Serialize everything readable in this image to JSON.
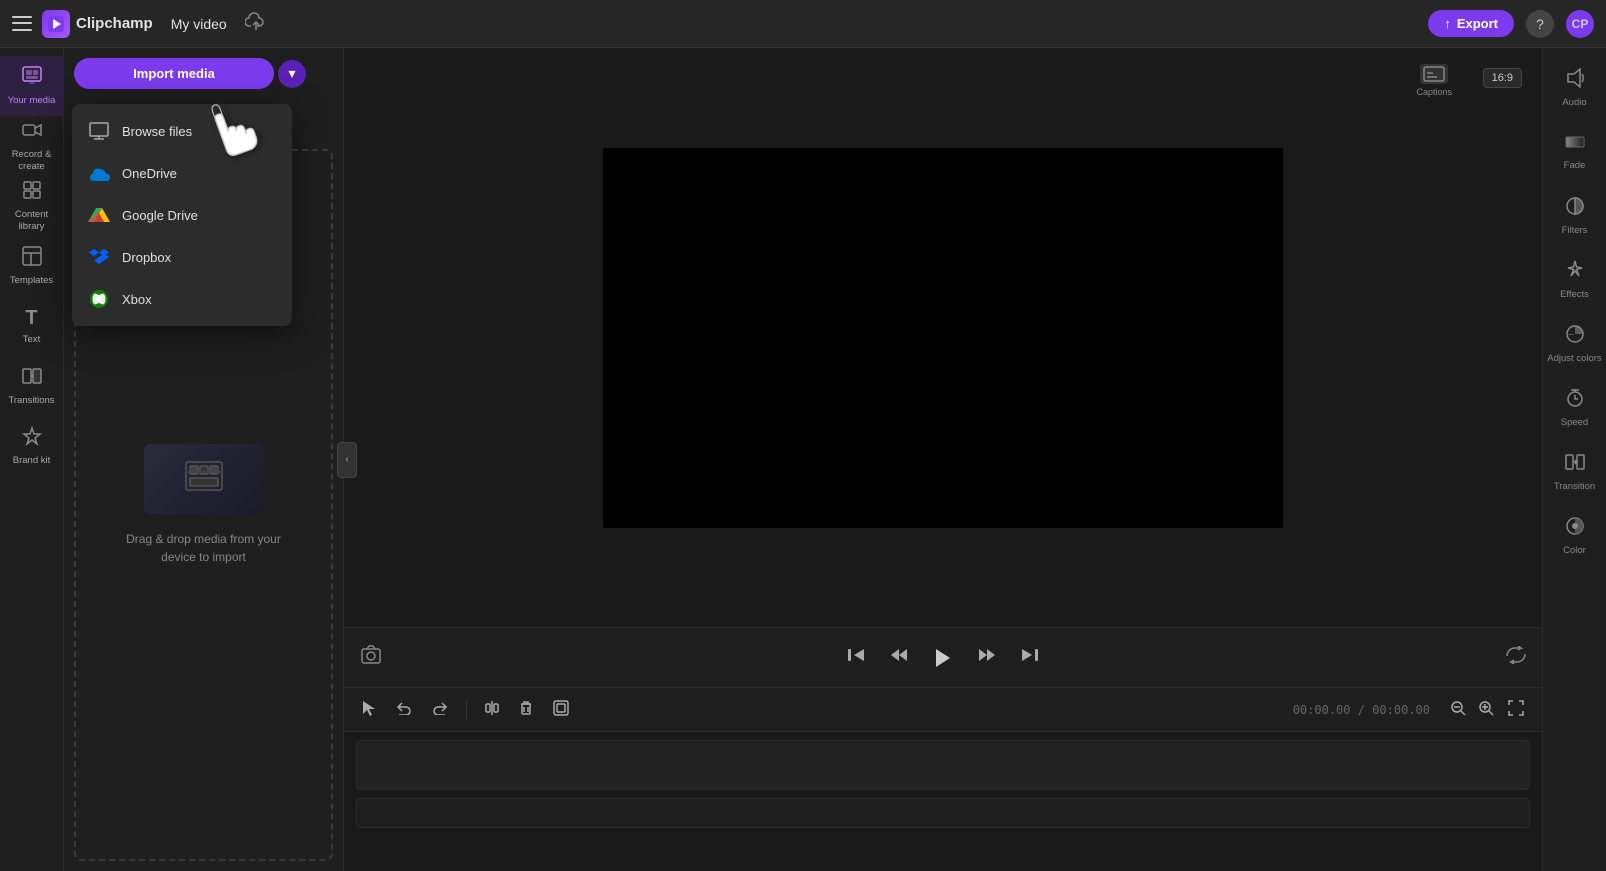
{
  "app": {
    "name": "Clipchamp",
    "logo_char": "▶",
    "video_title": "My video",
    "cloud_save_status": "unsaved"
  },
  "topbar": {
    "export_label": "Export",
    "aspect_ratio": "16:9",
    "captions_label": "Captions",
    "help_icon_label": "?",
    "avatar_label": "CP"
  },
  "left_sidebar": {
    "items": [
      {
        "id": "your-media",
        "icon": "🎞",
        "label": "Your media",
        "active": true
      },
      {
        "id": "record-create",
        "icon": "🎥",
        "label": "Record &\ncreate",
        "active": false
      },
      {
        "id": "content-library",
        "icon": "📚",
        "label": "Content\nlibrary",
        "active": false
      },
      {
        "id": "templates",
        "icon": "⊞",
        "label": "Templates",
        "active": false
      },
      {
        "id": "text",
        "icon": "T",
        "label": "Text",
        "active": false
      },
      {
        "id": "transitions",
        "icon": "◧",
        "label": "Transitions",
        "active": false
      },
      {
        "id": "brand-kit",
        "icon": "🏷",
        "label": "Brand kit",
        "active": false
      }
    ]
  },
  "media_panel": {
    "import_btn_label": "Import media",
    "import_arrow": "▾",
    "dropdown": {
      "visible": true,
      "items": [
        {
          "id": "browse-files",
          "icon": "monitor",
          "label": "Browse files"
        },
        {
          "id": "onedrive",
          "icon": "onedrive",
          "label": "OneDrive"
        },
        {
          "id": "google-drive",
          "icon": "gdrive",
          "label": "Google Drive"
        },
        {
          "id": "dropbox",
          "icon": "dropbox",
          "label": "Dropbox"
        },
        {
          "id": "xbox",
          "icon": "xbox",
          "label": "Xbox"
        }
      ]
    },
    "drag_drop_text": "Drag & drop media from your device to import"
  },
  "preview": {
    "aspect_ratio": "16:9"
  },
  "playback": {
    "time_current": "00:00.00",
    "time_total": "00:00.00",
    "time_separator": "/"
  },
  "right_sidebar": {
    "items": [
      {
        "id": "audio",
        "icon": "🔊",
        "label": "Audio"
      },
      {
        "id": "fade",
        "icon": "⬜",
        "label": "Fade"
      },
      {
        "id": "filters",
        "icon": "◑",
        "label": "Filters"
      },
      {
        "id": "effects",
        "icon": "✦",
        "label": "Effects"
      },
      {
        "id": "adjust-colors",
        "icon": "◑",
        "label": "Adjust\ncolors"
      },
      {
        "id": "speed",
        "icon": "⏱",
        "label": "Speed"
      },
      {
        "id": "transition",
        "icon": "⧉",
        "label": "Transition"
      },
      {
        "id": "color",
        "icon": "◐",
        "label": "Color"
      }
    ]
  }
}
